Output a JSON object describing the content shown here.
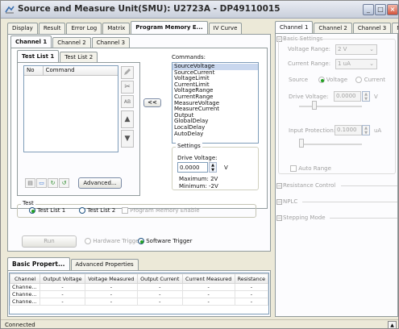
{
  "window": {
    "title": "Source and Measure Unit(SMU): U2723A - DP49110015"
  },
  "main_tabs": [
    "Display",
    "Result",
    "Error Log",
    "Matrix",
    "Program Memory E...",
    "IV Curve"
  ],
  "channel_tabs": [
    "Channel 1",
    "Channel 2",
    "Channel 3"
  ],
  "test_list_tabs": [
    "Test List 1",
    "Test List 2"
  ],
  "command_table": {
    "headers": [
      "No",
      "Command"
    ]
  },
  "commands_label": "Commands:",
  "commands": [
    "SourceVoltage",
    "SourceCurrent",
    "VoltageLimit",
    "CurrentLimit",
    "VoltageRange",
    "CurrentRange",
    "MeasureVoltage",
    "MeasureCurrent",
    "Output",
    "GlobalDelay",
    "LocalDelay",
    "AutoDelay"
  ],
  "add_button": "<<",
  "advanced_button": "Advanced...",
  "settings": {
    "label": "Settings",
    "drive_voltage_label": "Drive Voltage:",
    "drive_voltage_value": "0.0000",
    "unit": "V",
    "maximum": "Maximum: 2V",
    "minimum": "Minimum: -2V"
  },
  "test": {
    "label": "Test",
    "option1": "Test List 1",
    "option2": "Test List 2",
    "enable_label": "Program Memory Enable"
  },
  "run_button": "Run",
  "hardware_trigger": "Hardware Trigger",
  "software_trigger": "Software Trigger",
  "bottom_tabs": [
    "Basic Propert...",
    "Advanced Properties"
  ],
  "results_table": {
    "headers": [
      "Channel",
      "Output Voltage",
      "Voltage Measured",
      "Output Current",
      "Current Measured",
      "Resistance"
    ],
    "rows": [
      [
        "Channe...",
        "-",
        "-",
        "-",
        "-",
        "-"
      ],
      [
        "Channe...",
        "-",
        "-",
        "-",
        "-",
        "-"
      ],
      [
        "Channe...",
        "-",
        "-",
        "-",
        "-",
        "-"
      ]
    ]
  },
  "right_tabs": [
    "Channel 1",
    "Channel 2",
    "Channel 3",
    "Matrix"
  ],
  "basic_settings": {
    "label": "Basic Settings",
    "voltage_range_label": "Voltage Range:",
    "voltage_range_value": "2 V",
    "current_range_label": "Current Range:",
    "current_range_value": "1 uA",
    "source_label": "Source",
    "source_voltage": "Voltage",
    "source_current": "Current",
    "drive_voltage_label": "Drive Voltage:",
    "drive_voltage_value": "0.0000",
    "drive_voltage_unit": "V",
    "input_protection_label": "Input Protection:",
    "input_protection_value": "0.1000",
    "input_protection_unit": "uA",
    "auto_range_label": "Auto Range"
  },
  "sections": [
    "Resistance Control",
    "NPLC",
    "Stepping Mode"
  ],
  "status": "Connected"
}
